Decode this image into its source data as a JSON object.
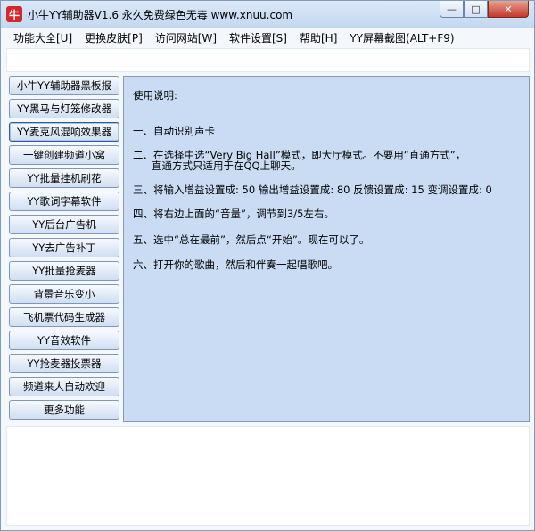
{
  "window": {
    "title": "小牛YY辅助器V1.6 永久免费绿色无毒 www.xnuu.com",
    "icon_label": "牛"
  },
  "window_buttons": {
    "minimize": "—",
    "maximize": "□",
    "close": "✕"
  },
  "menu": [
    "功能大全[U]",
    "更换皮肤[P]",
    "访问网站[W]",
    "软件设置[S]",
    "帮助[H]",
    "YY屏幕截图(ALT+F9)"
  ],
  "sidebar": [
    "小牛YY辅助器黑板报",
    "YY黑马与灯笼修改器",
    "YY麦克风混响效果器",
    "一键创建频道小窝",
    "YY批量挂机刷花",
    "YY歌词字幕软件",
    "YY后台广告机",
    "YY去广告补丁",
    "YY批量抢麦器",
    "背景音乐变小",
    "飞机票代码生成器",
    "YY音效软件",
    "YY抢麦器投票器",
    "频道来人自动欢迎",
    "更多功能"
  ],
  "content": {
    "title": "使用说明:",
    "line1": "一、自动识别声卡",
    "line2a": "二、在选择中选“Very Big Hall”模式，即大厅模式。不要用“直通方式”，",
    "line2b": "直通方式只适用于在QQ上聊天。",
    "line3": "三、将输入增益设置成: 50 输出增益设置成: 80 反馈设置成: 15 变调设置成: 0",
    "line4": "四、将右边上面的“音量”，调节到3/5左右。",
    "line5": "五、选中“总在最前”，然后点“开始”。现在可以了。",
    "line6": "六、打开你的歌曲，然后和伴奏一起唱歌吧。"
  },
  "colors": {
    "panel_bg": "#c9dcf3",
    "close_btn": "#c4372a",
    "app_icon": "#d7262b"
  }
}
